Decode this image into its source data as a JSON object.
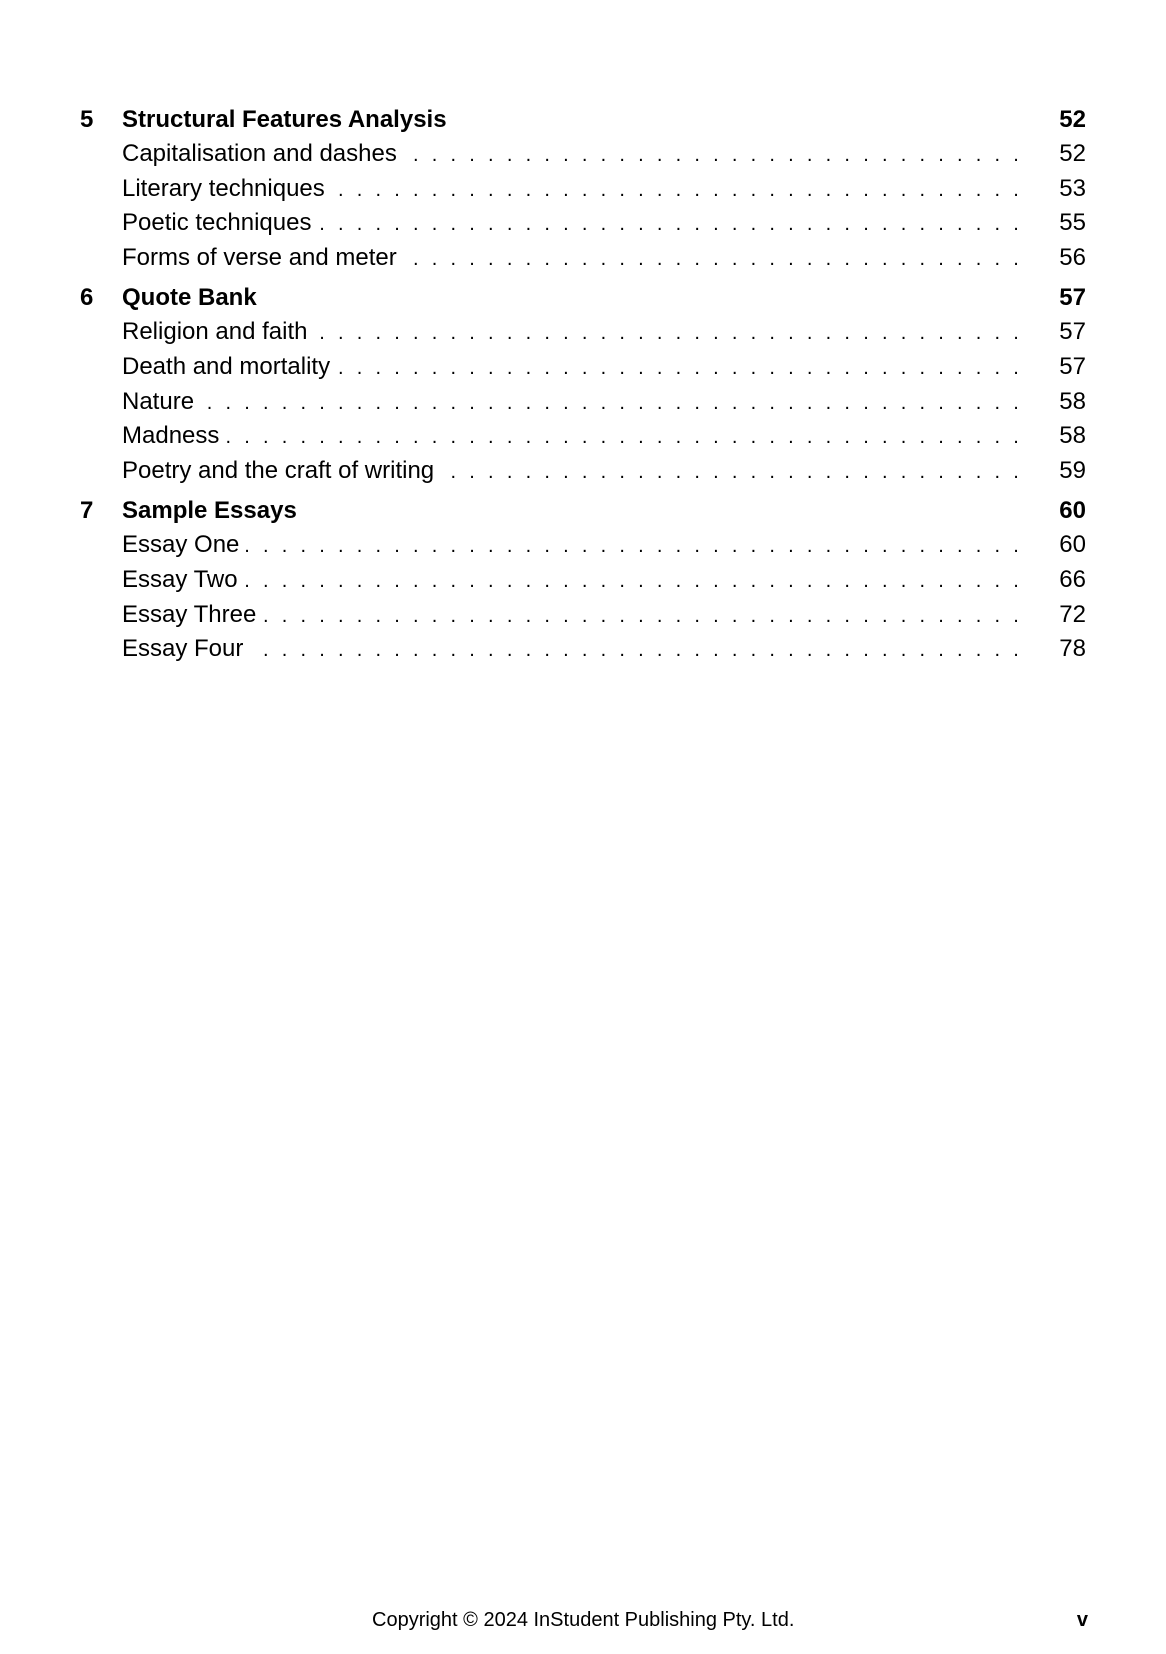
{
  "toc": {
    "chapters": [
      {
        "number": "5",
        "title": "Structural Features Analysis",
        "page": "52",
        "entries": [
          {
            "title": "Capitalisation and dashes",
            "page": "52"
          },
          {
            "title": "Literary techniques",
            "page": "53"
          },
          {
            "title": "Poetic techniques",
            "page": "55"
          },
          {
            "title": "Forms of verse and meter",
            "page": "56"
          }
        ]
      },
      {
        "number": "6",
        "title": "Quote Bank",
        "page": "57",
        "entries": [
          {
            "title": "Religion and faith",
            "page": "57"
          },
          {
            "title": "Death and mortality",
            "page": "57"
          },
          {
            "title": "Nature",
            "page": "58"
          },
          {
            "title": "Madness",
            "page": "58"
          },
          {
            "title": "Poetry and the craft of writing",
            "page": "59"
          }
        ]
      },
      {
        "number": "7",
        "title": "Sample Essays",
        "page": "60",
        "entries": [
          {
            "title": "Essay One",
            "page": "60"
          },
          {
            "title": "Essay Two",
            "page": "66"
          },
          {
            "title": "Essay Three",
            "page": "72"
          },
          {
            "title": "Essay Four",
            "page": "78"
          }
        ]
      }
    ],
    "leader_char": "."
  },
  "footer": {
    "copyright": "Copyright © 2024 InStudent Publishing Pty. Ltd.",
    "page_number": "v"
  }
}
